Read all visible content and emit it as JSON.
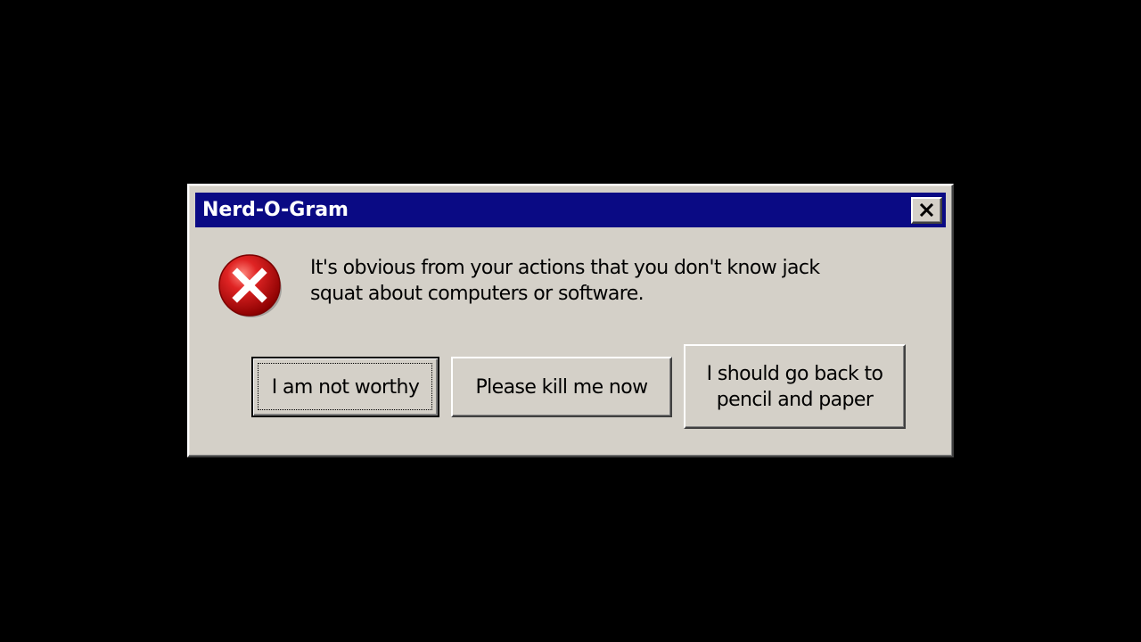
{
  "dialog": {
    "title": "Nerd-O-Gram",
    "close_icon": "close-icon",
    "status_icon": "error-icon",
    "message_lines": [
      "It's obvious from your actions that you don't know jack",
      "squat about computers or software."
    ],
    "buttons": [
      {
        "label": "I am not worthy",
        "default": true
      },
      {
        "label": "Please kill me now",
        "default": false
      },
      {
        "label_lines": [
          "I should go back to",
          "pencil and paper"
        ],
        "default": false
      }
    ]
  },
  "colors": {
    "background": "#000000",
    "dialog_face": "#d4d0c8",
    "titlebar": "#0a0a84",
    "title_text": "#ffffff",
    "error_red": "#d42020"
  }
}
